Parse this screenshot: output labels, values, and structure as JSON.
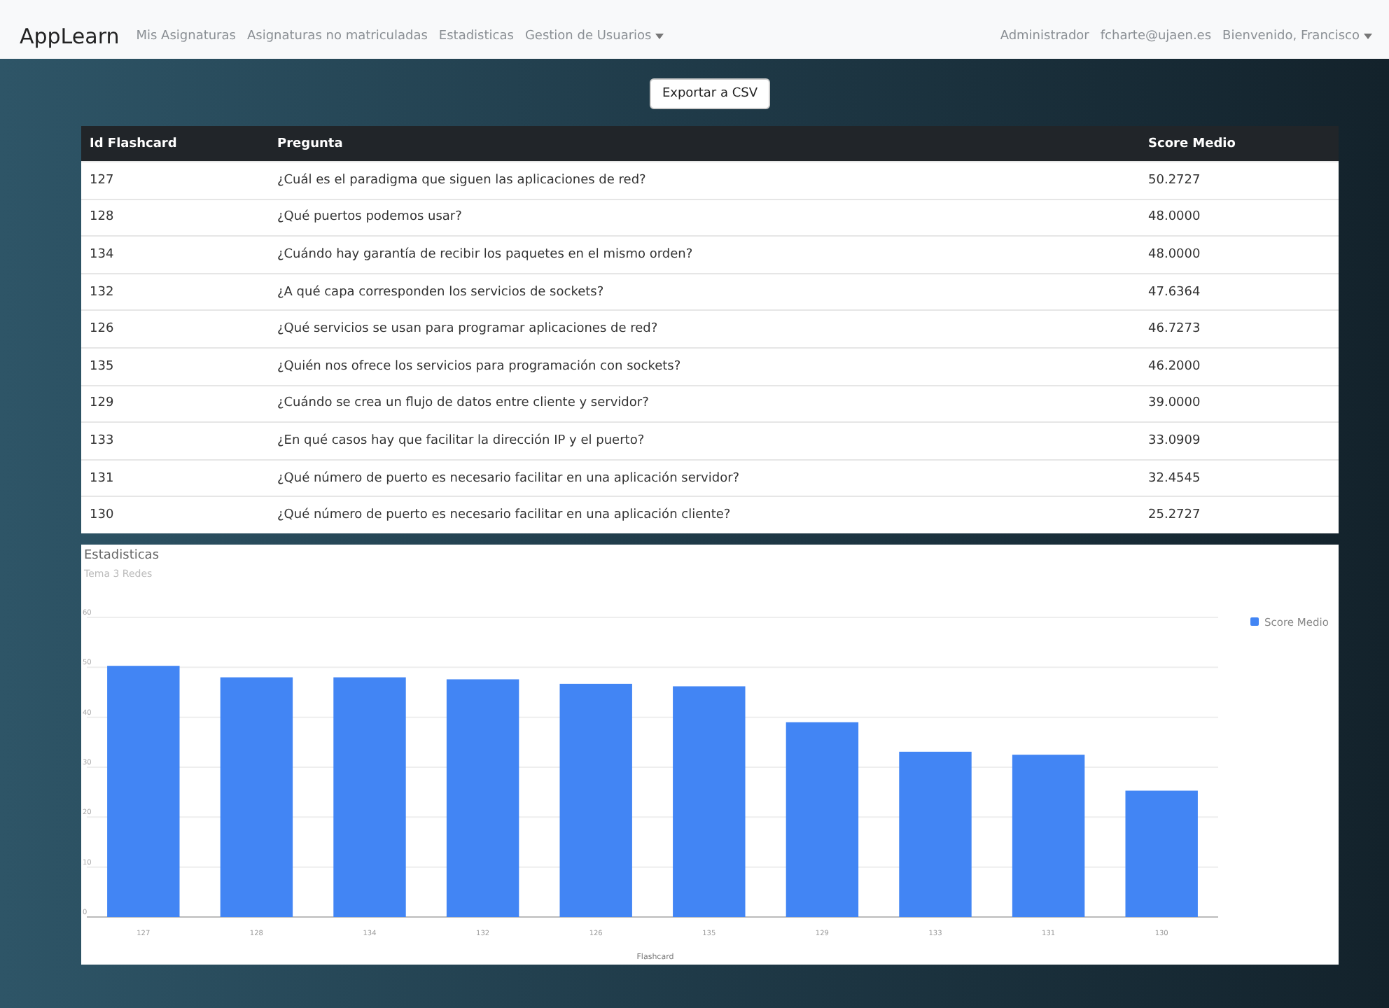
{
  "navbar": {
    "brand": "AppLearn",
    "links": [
      {
        "label": "Mis Asignaturas",
        "dropdown": false
      },
      {
        "label": "Asignaturas no matriculadas",
        "dropdown": false
      },
      {
        "label": "Estadisticas",
        "dropdown": false
      },
      {
        "label": "Gestion de Usuarios",
        "dropdown": true
      }
    ],
    "right": [
      {
        "label": "Administrador",
        "dropdown": false
      },
      {
        "label": "fcharte@ujaen.es",
        "dropdown": false
      },
      {
        "label": "Bienvenido, Francisco",
        "dropdown": true
      }
    ]
  },
  "export_button": "Exportar a CSV",
  "table": {
    "columns": [
      "Id Flashcard",
      "Pregunta",
      "Score Medio"
    ],
    "rows": [
      [
        "127",
        "¿Cuál es el paradigma que siguen las aplicaciones de red?",
        "50.2727"
      ],
      [
        "128",
        "¿Qué puertos podemos usar?",
        "48.0000"
      ],
      [
        "134",
        "¿Cuándo hay garantía de recibir los paquetes en el mismo orden?",
        "48.0000"
      ],
      [
        "132",
        "¿A qué capa corresponden los servicios de sockets?",
        "47.6364"
      ],
      [
        "126",
        "¿Qué servicios se usan para programar aplicaciones de red?",
        "46.7273"
      ],
      [
        "135",
        "¿Quién nos ofrece los servicios para programación con sockets?",
        "46.2000"
      ],
      [
        "129",
        "¿Cuándo se crea un flujo de datos entre cliente y servidor?",
        "39.0000"
      ],
      [
        "133",
        "¿En qué casos hay que facilitar la dirección IP y el puerto?",
        "33.0909"
      ],
      [
        "131",
        "¿Qué número de puerto es necesario facilitar en una aplicación servidor?",
        "32.4545"
      ],
      [
        "130",
        "¿Qué número de puerto es necesario facilitar en una aplicación cliente?",
        "25.2727"
      ]
    ]
  },
  "chart": {
    "chart_data": {
      "type": "bar",
      "title": "Estadisticas",
      "subtitle": "Tema 3 Redes",
      "xlabel": "Flashcard",
      "categories": [
        "127",
        "128",
        "134",
        "132",
        "126",
        "135",
        "129",
        "133",
        "131",
        "130"
      ],
      "series": [
        {
          "name": "Score Medio",
          "color": "#4285f4",
          "values": [
            50.3,
            48.0,
            48.0,
            47.6,
            46.7,
            46.2,
            39.0,
            33.1,
            32.5,
            25.3
          ]
        }
      ],
      "grid": true,
      "ylim": [
        0,
        60
      ],
      "yticks": [
        0,
        10,
        20,
        30,
        40,
        50,
        60
      ]
    }
  }
}
